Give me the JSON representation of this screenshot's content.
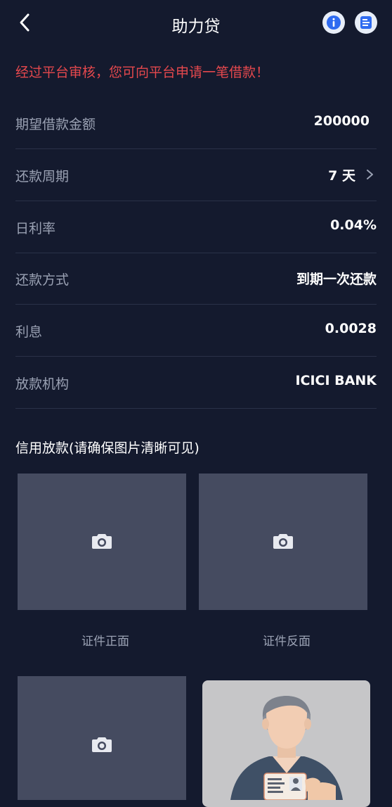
{
  "header": {
    "title": "助力贷"
  },
  "notice": "经过平台审核，您可向平台申请一笔借款！",
  "rows": [
    {
      "label": "期望借款金额",
      "value": "200000"
    },
    {
      "label": "还款周期",
      "value": "7 天"
    },
    {
      "label": "日利率",
      "value": "0.04%"
    },
    {
      "label": "还款方式",
      "value": "到期一次还款"
    },
    {
      "label": "利息",
      "value": "0.0028"
    },
    {
      "label": "放款机构",
      "value": "ICICI BANK"
    }
  ],
  "section": {
    "title": "信用放款(请确保图片清晰可见)"
  },
  "uploads": [
    {
      "label": "证件正面",
      "icon": "camera-icon"
    },
    {
      "label": "证件反面",
      "icon": "camera-icon"
    },
    {
      "label": "",
      "icon": "camera-icon"
    }
  ],
  "colors": {
    "background": "#141a2e",
    "accent_red": "#e5484d",
    "tile": "#454b60",
    "icon_blue": "#2f6bf0"
  }
}
